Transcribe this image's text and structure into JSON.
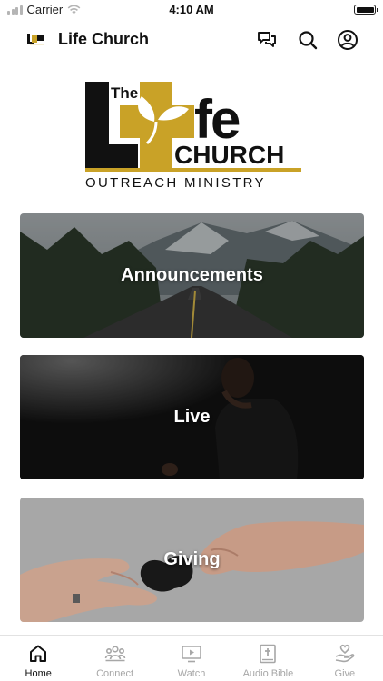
{
  "status_bar": {
    "carrier": "Carrier",
    "time": "4:10 AM"
  },
  "header": {
    "title": "Life Church",
    "icons": [
      "chat-icon",
      "search-icon",
      "profile-icon"
    ]
  },
  "logo": {
    "line1_prefix": "The",
    "line1_letters": "fe",
    "line2": "CHURCH",
    "line3": "OUTREACH MINISTRY",
    "accent_color": "#c9a227"
  },
  "cards": [
    {
      "label": "Announcements"
    },
    {
      "label": "Live"
    },
    {
      "label": "Giving"
    }
  ],
  "tabs": [
    {
      "label": "Home",
      "icon": "home-icon",
      "active": true
    },
    {
      "label": "Connect",
      "icon": "connect-icon",
      "active": false
    },
    {
      "label": "Watch",
      "icon": "watch-icon",
      "active": false
    },
    {
      "label": "Audio Bible",
      "icon": "bible-icon",
      "active": false
    },
    {
      "label": "Give",
      "icon": "give-icon",
      "active": false
    }
  ]
}
